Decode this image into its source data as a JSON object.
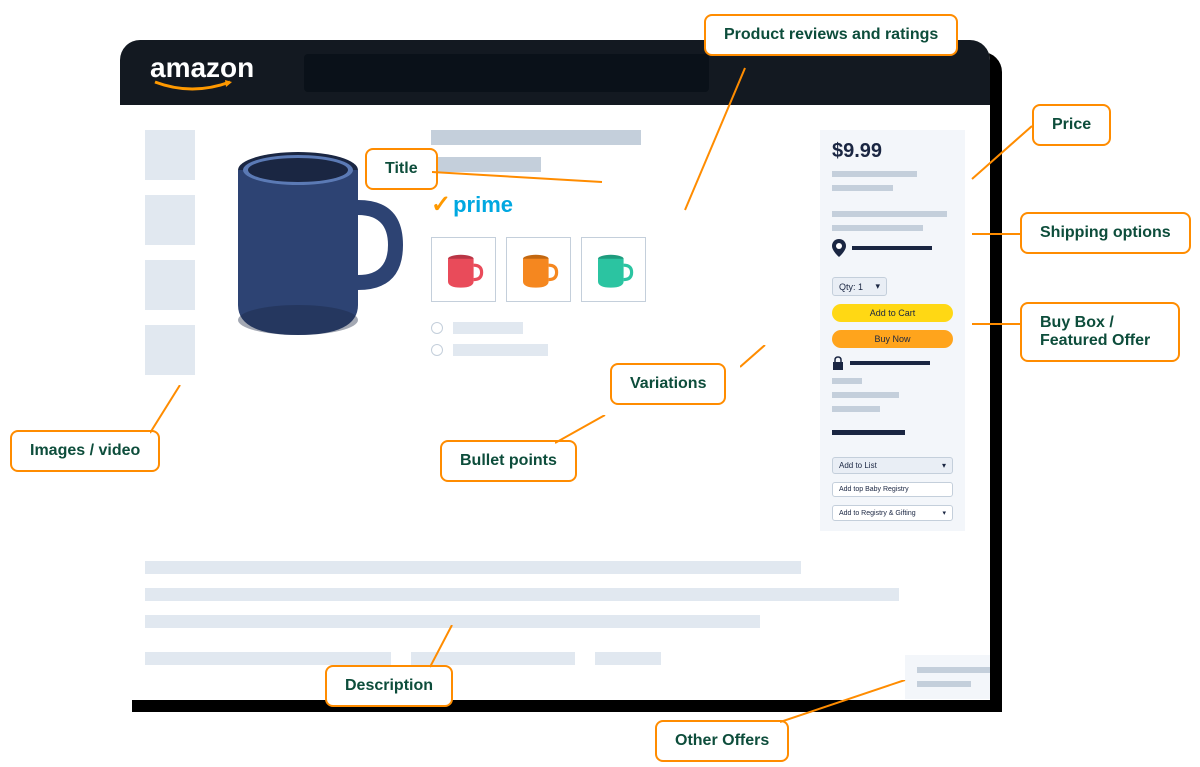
{
  "header": {
    "brand": "amazon"
  },
  "product": {
    "prime_label": "prime",
    "price": "$9.99",
    "qty_label": "Qty: 1",
    "add_to_cart": "Add to Cart",
    "buy_now": "Buy Now",
    "add_to_list": "Add to List",
    "add_baby_registry": "Add top Baby Registry",
    "add_registry_gifting": "Add to Registry & Gifting"
  },
  "variations": [
    {
      "color": "#e94b5a"
    },
    {
      "color": "#f5871f"
    },
    {
      "color": "#2bc4a1"
    }
  ],
  "main_mug_color": "#2d4373",
  "callouts": {
    "reviews": "Product reviews and ratings",
    "title": "Title",
    "price": "Price",
    "shipping": "Shipping options",
    "buybox": "Buy Box / Featured Offer",
    "variations": "Variations",
    "bullets": "Bullet points",
    "images": "Images / video",
    "description": "Description",
    "other_offers": "Other Offers"
  }
}
